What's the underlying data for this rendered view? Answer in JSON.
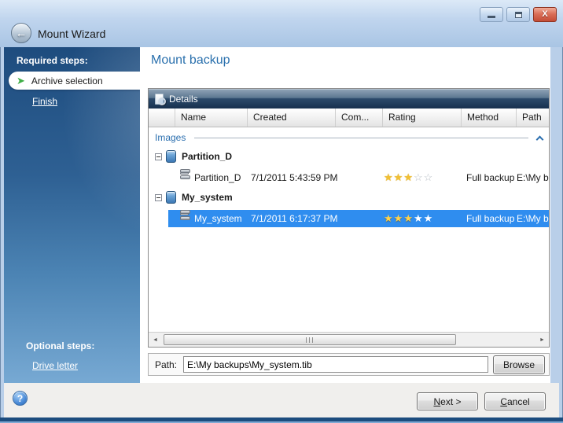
{
  "window": {
    "title": "Mount Wizard"
  },
  "sidebar": {
    "required_header": "Required steps:",
    "active_step": "Archive selection",
    "finish_link": "Finish",
    "optional_header": "Optional steps:",
    "drive_letter_link": "Drive letter"
  },
  "main": {
    "heading": "Mount backup",
    "details_label": "Details",
    "columns": {
      "name": "Name",
      "created": "Created",
      "comments": "Com...",
      "rating": "Rating",
      "method": "Method",
      "path": "Path"
    },
    "group_section": "Images",
    "groups": [
      {
        "name": "Partition_D",
        "item": {
          "name": "Partition_D",
          "created": "7/1/2011 5:43:59 PM",
          "rating": 3,
          "rating_max": 5,
          "method": "Full backup",
          "path": "E:\\My b",
          "selected": false
        }
      },
      {
        "name": "My_system",
        "item": {
          "name": "My_system",
          "created": "7/1/2011 6:17:37 PM",
          "rating": 3,
          "rating_max": 5,
          "method": "Full backup",
          "path": "E:\\My b",
          "selected": true
        }
      }
    ]
  },
  "path_bar": {
    "label": "Path:",
    "value": "E:\\My backups\\My_system.tib",
    "browse": "Browse"
  },
  "footer": {
    "next_u": "N",
    "next_rest": "ext >",
    "cancel_u": "C",
    "cancel_rest": "ancel"
  },
  "colors": {
    "selection": "#2f8def",
    "accent_blue": "#2a70ad",
    "star_gold": "#f2c033",
    "sidebar_top": "#1e4c7e",
    "sidebar_bottom": "#77a9d3",
    "close_red": "#c34c36"
  }
}
